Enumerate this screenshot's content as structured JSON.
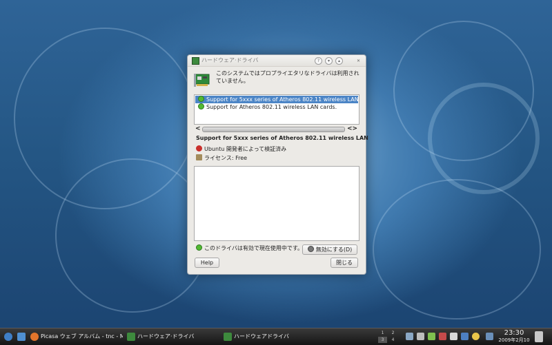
{
  "dialog": {
    "title": "ハードウェア·ドライバ",
    "titlebar_buttons": [
      "?",
      "▾",
      "▴",
      "✕"
    ],
    "header_text": "このシステムではプロプライエタリなドライバは利用されていません。",
    "drivers": [
      {
        "label": "Support for 5xxx series of Atheros 802.11 wireless LAN ca",
        "selected": true
      },
      {
        "label": "Support for Atheros 802.11 wireless LAN cards.",
        "selected": false
      }
    ],
    "scroll_left": "<",
    "scroll_right": "<>",
    "detail_title": "Support for 5xxx series of Atheros 802.11 wireless LAN",
    "verified_text": "Ubuntu 開発者によって検証済み",
    "license_text": "ライセンス: Free",
    "status_text": "このドライバは有効で現在使用中です。",
    "disable_button": "無効にする(D)",
    "help_button": "Help",
    "close_button": "閉じる"
  },
  "taskbar": {
    "tasks": [
      {
        "label": "Picasa ウェブ アルバム - tnc - Mo"
      },
      {
        "label": "ハードウェア·ドライバ"
      },
      {
        "label": "ハードウェアドライバ"
      }
    ],
    "pager": [
      "1",
      "2",
      "3",
      "4"
    ],
    "clock_time": "23:30",
    "clock_date": "2009年2月10"
  },
  "colors": {
    "selection": "#4c85c6",
    "driver_active": "#53b932",
    "desktop": "#2f6497"
  }
}
